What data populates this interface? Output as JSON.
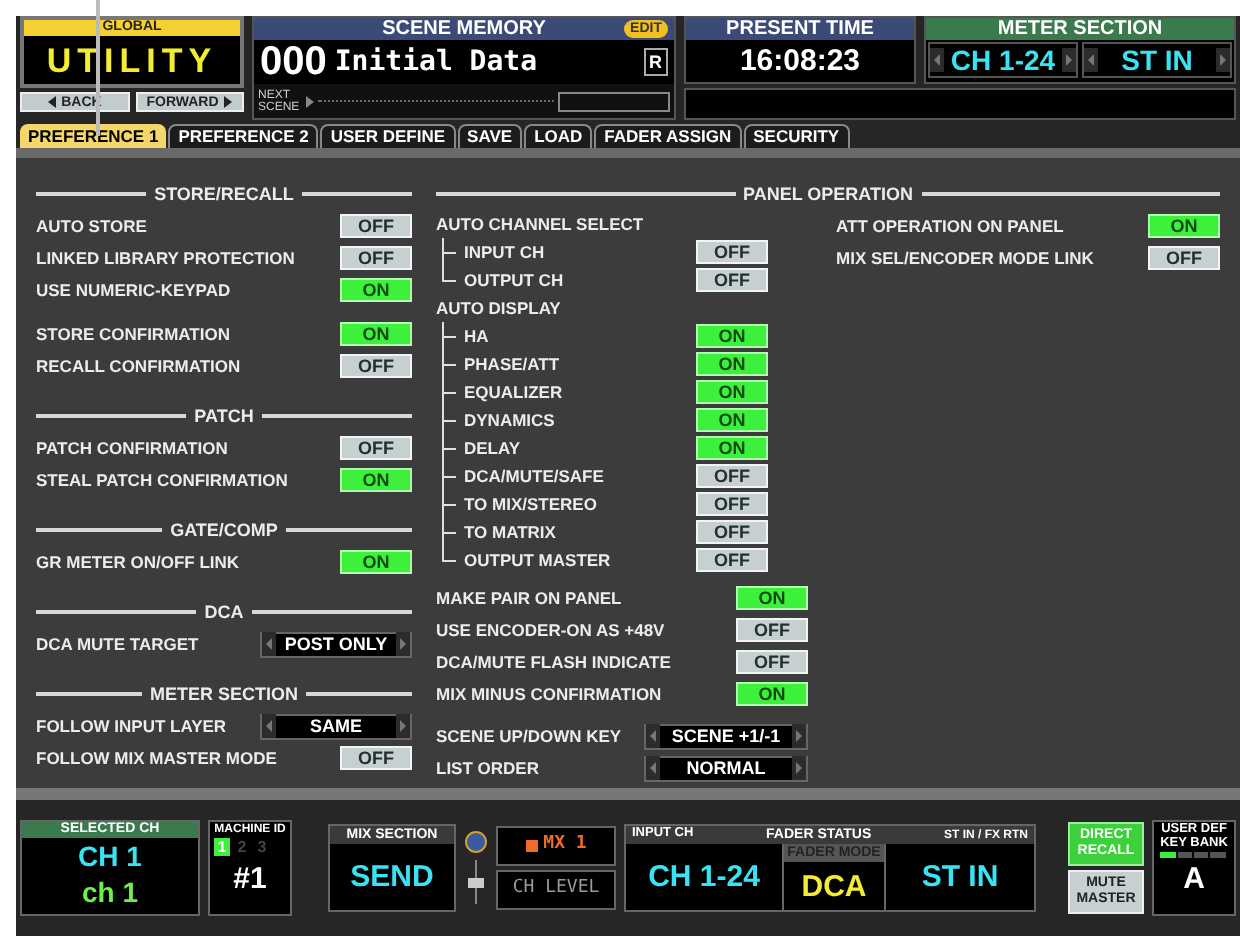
{
  "header": {
    "global": {
      "label": "GLOBAL",
      "title": "UTILITY"
    },
    "nav_buttons": [
      {
        "label": "BACK",
        "kind": "back"
      },
      {
        "label": "FORWARD",
        "kind": "forward"
      }
    ],
    "scene_memory": {
      "title": "SCENE MEMORY",
      "badge": "EDIT",
      "number": "000",
      "name": "Initial Data",
      "flag": "R",
      "next_label": "NEXT SCENE"
    },
    "present_time": {
      "title": "PRESENT TIME",
      "time": "16:08:23"
    },
    "meter_section": {
      "title": "METER SECTION",
      "selectors": [
        "CH 1-24",
        "ST IN"
      ]
    }
  },
  "tabs": [
    {
      "label": "PREFERENCE 1",
      "selected": true
    },
    {
      "label": "PREFERENCE 2",
      "selected": false
    },
    {
      "label": "USER DEFINE",
      "selected": false
    },
    {
      "label": "SAVE",
      "selected": false
    },
    {
      "label": "LOAD",
      "selected": false
    },
    {
      "label": "FADER ASSIGN",
      "selected": false
    },
    {
      "label": "SECURITY",
      "selected": false
    }
  ],
  "left_sections": [
    {
      "title": "STORE/RECALL",
      "groups": [
        [
          {
            "kind": "toggle",
            "label": "AUTO STORE",
            "value": "OFF",
            "on": false
          },
          {
            "kind": "toggle",
            "label": "LINKED LIBRARY PROTECTION",
            "value": "OFF",
            "on": false
          },
          {
            "kind": "toggle",
            "label": "USE NUMERIC-KEYPAD",
            "value": "ON",
            "on": true
          }
        ],
        [
          {
            "kind": "toggle",
            "label": "STORE CONFIRMATION",
            "value": "ON",
            "on": true
          },
          {
            "kind": "toggle",
            "label": "RECALL CONFIRMATION",
            "value": "OFF",
            "on": false
          }
        ]
      ]
    },
    {
      "title": "PATCH",
      "groups": [
        [
          {
            "kind": "toggle",
            "label": "PATCH CONFIRMATION",
            "value": "OFF",
            "on": false
          },
          {
            "kind": "toggle",
            "label": "STEAL PATCH CONFIRMATION",
            "value": "ON",
            "on": true
          }
        ]
      ]
    },
    {
      "title": "GATE/COMP",
      "groups": [
        [
          {
            "kind": "toggle",
            "label": "GR METER ON/OFF LINK",
            "value": "ON",
            "on": true
          }
        ]
      ]
    },
    {
      "title": "DCA",
      "groups": [
        [
          {
            "kind": "select",
            "label": "DCA MUTE TARGET",
            "value": "POST ONLY"
          }
        ]
      ]
    },
    {
      "title": "METER SECTION",
      "groups": [
        [
          {
            "kind": "select",
            "label": "FOLLOW INPUT LAYER",
            "value": "SAME"
          },
          {
            "kind": "toggle",
            "label": "FOLLOW MIX MASTER MODE",
            "value": "OFF",
            "on": false
          }
        ]
      ]
    }
  ],
  "panel_operation": {
    "title": "PANEL OPERATION",
    "columns": [
      [
        {
          "kind": "heading",
          "label": "AUTO CHANNEL SELECT",
          "children": [
            {
              "kind": "toggle",
              "label": "INPUT CH",
              "value": "OFF",
              "on": false
            },
            {
              "kind": "toggle",
              "label": "OUTPUT CH",
              "value": "OFF",
              "on": false
            }
          ]
        },
        {
          "kind": "heading",
          "label": "AUTO DISPLAY",
          "children": [
            {
              "kind": "toggle",
              "label": "HA",
              "value": "ON",
              "on": true
            },
            {
              "kind": "toggle",
              "label": "PHASE/ATT",
              "value": "ON",
              "on": true
            },
            {
              "kind": "toggle",
              "label": "EQUALIZER",
              "value": "ON",
              "on": true
            },
            {
              "kind": "toggle",
              "label": "DYNAMICS",
              "value": "ON",
              "on": true
            },
            {
              "kind": "toggle",
              "label": "DELAY",
              "value": "ON",
              "on": true
            },
            {
              "kind": "toggle",
              "label": "DCA/MUTE/SAFE",
              "value": "OFF",
              "on": false
            },
            {
              "kind": "toggle",
              "label": "TO MIX/STEREO",
              "value": "OFF",
              "on": false
            },
            {
              "kind": "toggle",
              "label": "TO MATRIX",
              "value": "OFF",
              "on": false
            },
            {
              "kind": "toggle",
              "label": "OUTPUT MASTER",
              "value": "OFF",
              "on": false
            }
          ]
        },
        {
          "kind": "toggle",
          "label": "MAKE PAIR ON PANEL",
          "value": "ON",
          "on": true
        },
        {
          "kind": "toggle",
          "label": "USE ENCODER-ON AS +48V",
          "value": "OFF",
          "on": false
        },
        {
          "kind": "toggle",
          "label": "DCA/MUTE FLASH INDICATE",
          "value": "OFF",
          "on": false
        },
        {
          "kind": "toggle",
          "label": "MIX MINUS CONFIRMATION",
          "value": "ON",
          "on": true
        },
        {
          "kind": "select",
          "label": "SCENE UP/DOWN KEY",
          "value": "SCENE +1/-1"
        },
        {
          "kind": "select",
          "label": "LIST ORDER",
          "value": "NORMAL"
        }
      ],
      [
        {
          "kind": "toggle",
          "label": "ATT OPERATION ON PANEL",
          "value": "ON",
          "on": true
        },
        {
          "kind": "toggle",
          "label": "MIX SEL/ENCODER MODE LINK",
          "value": "OFF",
          "on": false
        }
      ]
    ]
  },
  "bottom_bar": {
    "selected_ch": {
      "title": "SELECTED CH",
      "name": "CH 1",
      "short_name": "ch 1"
    },
    "machine_id": {
      "title": "MACHINE ID",
      "ids": [
        {
          "label": "1",
          "selected": true
        },
        {
          "label": "2",
          "selected": false
        },
        {
          "label": "3",
          "selected": false
        }
      ],
      "value": "#1"
    },
    "mix_section": {
      "title": "MIX SECTION",
      "value": "SEND"
    },
    "mix_bus": "MX 1",
    "ch_level": "CH LEVEL",
    "fader_status": {
      "title": "FADER STATUS",
      "left_label": "INPUT CH",
      "right_label": "ST IN / FX RTN",
      "left_value": "CH 1-24",
      "mode_label": "FADER MODE",
      "mode": "DCA",
      "right_value": "ST IN"
    },
    "direct_recall": {
      "label": "DIRECT RECALL",
      "on": true
    },
    "mute_master": {
      "label": "MUTE MASTER",
      "on": false
    },
    "key_bank": {
      "title": "USER DEF KEY BANK",
      "value": "A"
    }
  }
}
